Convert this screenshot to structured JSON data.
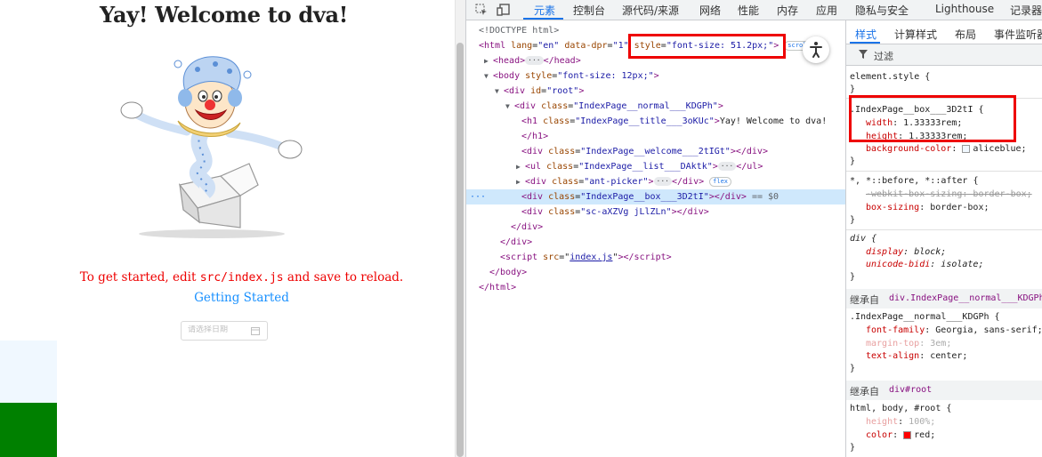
{
  "app": {
    "title": "Yay! Welcome to dva!",
    "started_prefix": "To get started, edit ",
    "started_code": "src/index.js",
    "started_suffix": " and save to reload.",
    "link": "Getting Started",
    "picker_placeholder": "请选择日期",
    "box_color": "#f0f8ff",
    "green_color": "#008000"
  },
  "devtools": {
    "tabs": [
      "元素",
      "控制台",
      "源代码/来源",
      "网络",
      "性能",
      "内存",
      "应用",
      "隐私与安全",
      "Lighthouse",
      "记录器"
    ],
    "active_tab": "元素",
    "dom": {
      "doctype": "<!DOCTYPE html>",
      "html_open_a": "<html ",
      "html_lang_attr": "lang",
      "html_lang_val": "\"en\"",
      "html_dpr_attr": "data-dpr",
      "html_dpr_val": "\"1\"",
      "html_style_attr": "style",
      "html_style_val": "\"font-size: 51.2px;\"",
      "html_close": ">",
      "html_badge": "scroll",
      "head": "<head>",
      "head_close": "</head>",
      "body_open": "<body ",
      "body_style_attr": "style",
      "body_style_val": "\"font-size: 12px;\"",
      "root_id_attr": "id",
      "root_id_val": "\"root\"",
      "normal_class_val": "\"IndexPage__normal___KDGPh\"",
      "h1_class_val": "\"IndexPage__title___3oKUc\"",
      "h1_text": "Yay! Welcome to dva!",
      "welcome_class_val": "\"IndexPage__welcome___2tIGt\"",
      "ul_class_val": "\"IndexPage__list___DAktk\"",
      "picker_class_val": "\"ant-picker\"",
      "picker_badge": "flex",
      "box_class_val": "\"IndexPage__box___3D2tI\"",
      "selected_suffix": "== $0",
      "sc_class_val": "\"sc-aXZVg jLlZLn\"",
      "script_src_val": "index.js"
    },
    "styles": {
      "tabs": [
        "样式",
        "计算样式",
        "布局",
        "事件监听器"
      ],
      "active_tab": "样式",
      "filter": "过滤",
      "element_style": "element.style {",
      "close_brace": "}",
      "box_selector": ".IndexPage__box___3D2tI {",
      "width_prop": "width",
      "width_val": "1.33333rem;",
      "height_prop": "height",
      "height_val": "1.33333rem;",
      "bg_prop": "background-color",
      "bg_val": "aliceblue;",
      "universal_selector": "*, *::before, *::after {",
      "webkit_prop": "-webkit-box-sizing",
      "webkit_val": "border-box;",
      "boxsizing_prop": "box-sizing",
      "boxsizing_val": "border-box;",
      "div_selector": "div {",
      "display_prop": "display",
      "display_val": "block;",
      "unicode_prop": "unicode-bidi",
      "unicode_val": "isolate;",
      "inherit1_label": "继承自",
      "inherit1_from": "div.IndexPage__normal___KDGPh",
      "normal_selector": ".IndexPage__normal___KDGPh {",
      "ff_prop": "font-family",
      "ff_val": "Georgia, sans-serif;",
      "mt_prop": "margin-top",
      "mt_val": "3em;",
      "ta_prop": "text-align",
      "ta_val": "center;",
      "inherit2_label": "继承自",
      "inherit2_from": "div#root",
      "root_selector": "html, body, #root {",
      "h_prop": "height",
      "h_val": "100%;",
      "color_prop": "color",
      "color_val": "red;"
    }
  }
}
